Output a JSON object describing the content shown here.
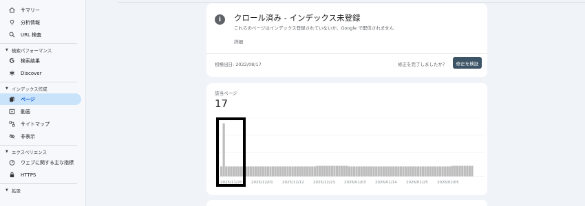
{
  "sidebar": {
    "top_items": [
      {
        "label": "サマリー",
        "icon": "home-icon"
      },
      {
        "label": "分析情報",
        "icon": "insights-icon"
      },
      {
        "label": "URL 検査",
        "icon": "search-icon"
      }
    ],
    "sections": [
      {
        "header": "検索パフォーマンス",
        "items": [
          {
            "label": "検索結果",
            "icon": "google-icon"
          },
          {
            "label": "Discover",
            "icon": "asterisk-icon"
          }
        ]
      },
      {
        "header": "インデックス作成",
        "items": [
          {
            "label": "ページ",
            "icon": "pages-icon",
            "active": true
          },
          {
            "label": "動画",
            "icon": "video-icon"
          },
          {
            "label": "サイトマップ",
            "icon": "sitemap-icon"
          },
          {
            "label": "非表示",
            "icon": "eye-off-icon"
          }
        ]
      },
      {
        "header": "エクスペリエンス",
        "items": [
          {
            "label": "ウェブに関する主な指標",
            "icon": "gauge-icon"
          },
          {
            "label": "HTTPS",
            "icon": "lock-icon"
          }
        ]
      },
      {
        "header": "拡張",
        "items": []
      }
    ]
  },
  "issue": {
    "title": "クロール済み - インデックス未登録",
    "description": "これらのページはインデックス登録されていないか、Google で配信されません",
    "details_link": "詳細",
    "first_detected": "初検出日: 2022/08/17",
    "fix_question": "修正を完了しましたか？",
    "validate_button": "修正を検証"
  },
  "chart_card": {
    "label": "該当ページ",
    "count": "17"
  },
  "chart_data": {
    "type": "bar",
    "title": "",
    "xlabel": "",
    "ylabel": "",
    "x_tick_labels": [
      "2025/11/20",
      "2025/12/01",
      "2025/12/12",
      "2025/12/23",
      "2026/01/03",
      "2026/01/14",
      "2026/01/25",
      "2026/02/05"
    ],
    "values": [
      17,
      90,
      17,
      17,
      17,
      17,
      17,
      17,
      17,
      17,
      17,
      17,
      17,
      17,
      17,
      17,
      17,
      17,
      17,
      17,
      17,
      17,
      17,
      17,
      17,
      17,
      17,
      17,
      17,
      17,
      17,
      17,
      17,
      17,
      17,
      17,
      17,
      17,
      17,
      18,
      18,
      18,
      18,
      18,
      18,
      18,
      18,
      18,
      18,
      18,
      18,
      18,
      17,
      17,
      17,
      17,
      17,
      17,
      17,
      17,
      17,
      17,
      17,
      17,
      17,
      17,
      17,
      17,
      17,
      17,
      17,
      17,
      17,
      17,
      17,
      17,
      17,
      17,
      17,
      17,
      17,
      17,
      17,
      17,
      17,
      17,
      17,
      17,
      17,
      17,
      17,
      17,
      17,
      17,
      18,
      18,
      18,
      18,
      18,
      18,
      18,
      18,
      18
    ],
    "bar_color": "#bdbdbd",
    "grid": true
  }
}
